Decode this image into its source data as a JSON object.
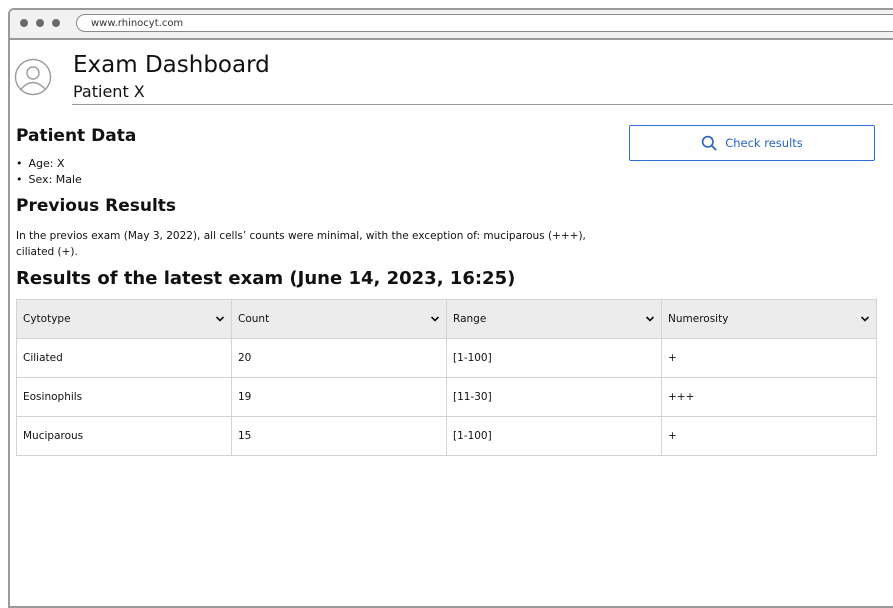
{
  "browser": {
    "url": "www.rhinocyt.com"
  },
  "header": {
    "title": "Exam Dashboard",
    "subtitle": "Patient X"
  },
  "patient_data": {
    "heading": "Patient Data",
    "items": [
      "Age: X",
      "Sex: Male"
    ]
  },
  "check_button": {
    "label": "Check results",
    "icon": "search-icon",
    "color": "#2f6fd0"
  },
  "previous_results": {
    "heading": "Previous Results",
    "text": "In the previos exam (May 3, 2022), all cells’ counts were minimal, with the exception of: muciparous (+++), ciliated (+)."
  },
  "latest": {
    "heading": "Results of the latest exam (June 14, 2023, 16:25)",
    "columns": [
      "Cytotype",
      "Count",
      "Range",
      "Numerosity"
    ],
    "rows": [
      [
        "Ciliated",
        "20",
        "[1-100]",
        "+"
      ],
      [
        "Eosinophils",
        "19",
        "[11-30]",
        "+++"
      ],
      [
        "Muciparous",
        "15",
        "[1-100]",
        "+"
      ]
    ]
  }
}
